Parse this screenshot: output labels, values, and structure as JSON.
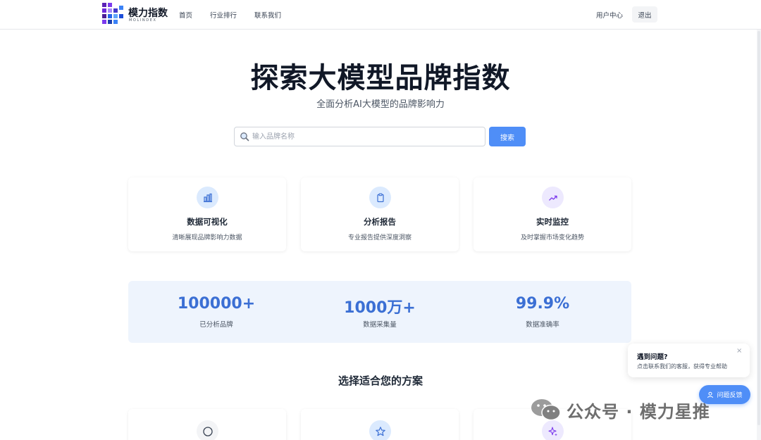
{
  "header": {
    "logo_text": "模力指数",
    "logo_sub": "MOLINDEX",
    "nav": [
      "首页",
      "行业排行",
      "联系我们"
    ],
    "user_center": "用户中心",
    "logout": "退出"
  },
  "hero": {
    "title": "探索大模型品牌指数",
    "subtitle": "全面分析AI大模型的品牌影响力",
    "search_placeholder": "输入品牌名称",
    "search_button": "搜索"
  },
  "features": [
    {
      "title": "数据可视化",
      "desc": "清晰展现品牌影响力数据",
      "icon": "bar-chart-icon"
    },
    {
      "title": "分析报告",
      "desc": "专业报告提供深度洞察",
      "icon": "clipboard-icon"
    },
    {
      "title": "实时监控",
      "desc": "及时掌握市场变化趋势",
      "icon": "trending-up-icon"
    }
  ],
  "stats": [
    {
      "value": "100000+",
      "label": "已分析品牌"
    },
    {
      "value": "1000万+",
      "label": "数据采集量"
    },
    {
      "value": "99.9%",
      "label": "数据准确率"
    }
  ],
  "plans": {
    "title": "选择适合您的方案",
    "icons": [
      "circle-icon",
      "star-icon",
      "sparkle-icon"
    ]
  },
  "help": {
    "title": "遇到问题?",
    "desc": "点击联系我们的客服，获得专业帮助",
    "close": "×",
    "feedback": "问题反馈"
  },
  "watermark": {
    "text": "公众号 · 模力星推"
  },
  "colors": {
    "accent": "#4f8ef7",
    "stat_value": "#3b6fd4",
    "stats_bg": "#eef4fd"
  }
}
